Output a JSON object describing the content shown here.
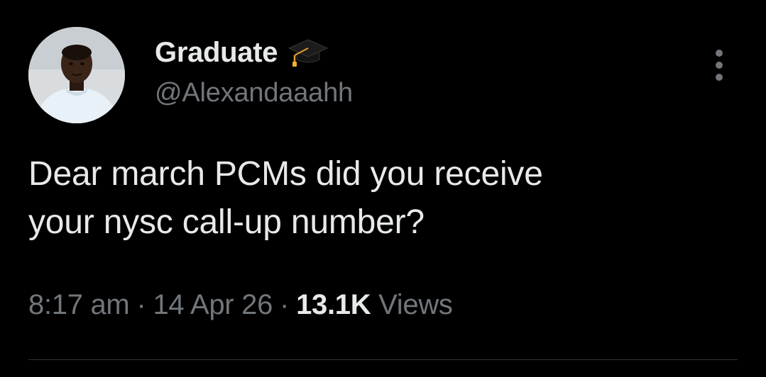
{
  "author": {
    "display_name": "Graduate",
    "badge_icon": "graduation-cap-icon",
    "handle": "@Alexandaaahh",
    "avatar_icon": "profile-photo"
  },
  "tweet": {
    "text_lines": [
      "Dear march PCMs did you receive",
      "your nysc call-up number?"
    ]
  },
  "meta": {
    "time": "8:17 am",
    "separator": "·",
    "date": "14 Apr 26",
    "views_count": "13.1K",
    "views_label": "Views"
  },
  "actions": {
    "more_icon": "more-vertical-icon"
  },
  "colors": {
    "background": "#000000",
    "primary_text": "#e7e9ea",
    "secondary_text": "#71767b",
    "divider": "#2f3336"
  }
}
